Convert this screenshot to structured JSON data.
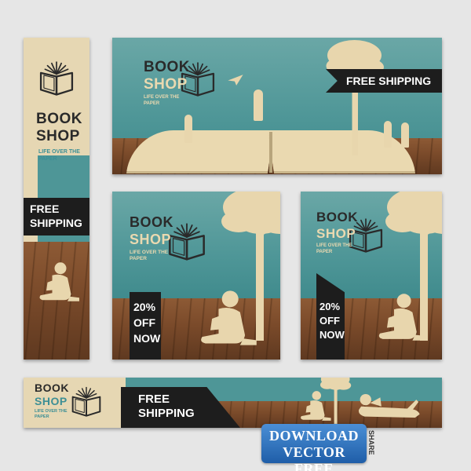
{
  "brand": {
    "word1": "BOOK",
    "word2": "SHOP",
    "tagline_line1": "LIFE OVER THE",
    "tagline_line2": "PAPER",
    "tagline_full": "LIFE OVER THE PAPER"
  },
  "offers": {
    "free_line1": "FREE",
    "free_line2": "SHIPPING",
    "free_full": "FREE SHIPPING",
    "discount_line1": "20%",
    "discount_line2": "OFF",
    "discount_line3": "NOW"
  },
  "watermark": {
    "line1": "DOWNLOAD",
    "line2": "VECTOR FREE",
    "side": "SHARE"
  },
  "colors": {
    "sky_teal": "#4e9697",
    "paper_beige": "#e6d7b3",
    "wood_brown": "#7a4a2a",
    "badge_dark": "#1d1d1d",
    "logo_teal": "#3d8f95",
    "watermark_blue": "#2d6fb3"
  },
  "icons": [
    "book-logo-icon",
    "tree-silhouette",
    "reading-child-silhouette",
    "paper-plane-icon"
  ]
}
